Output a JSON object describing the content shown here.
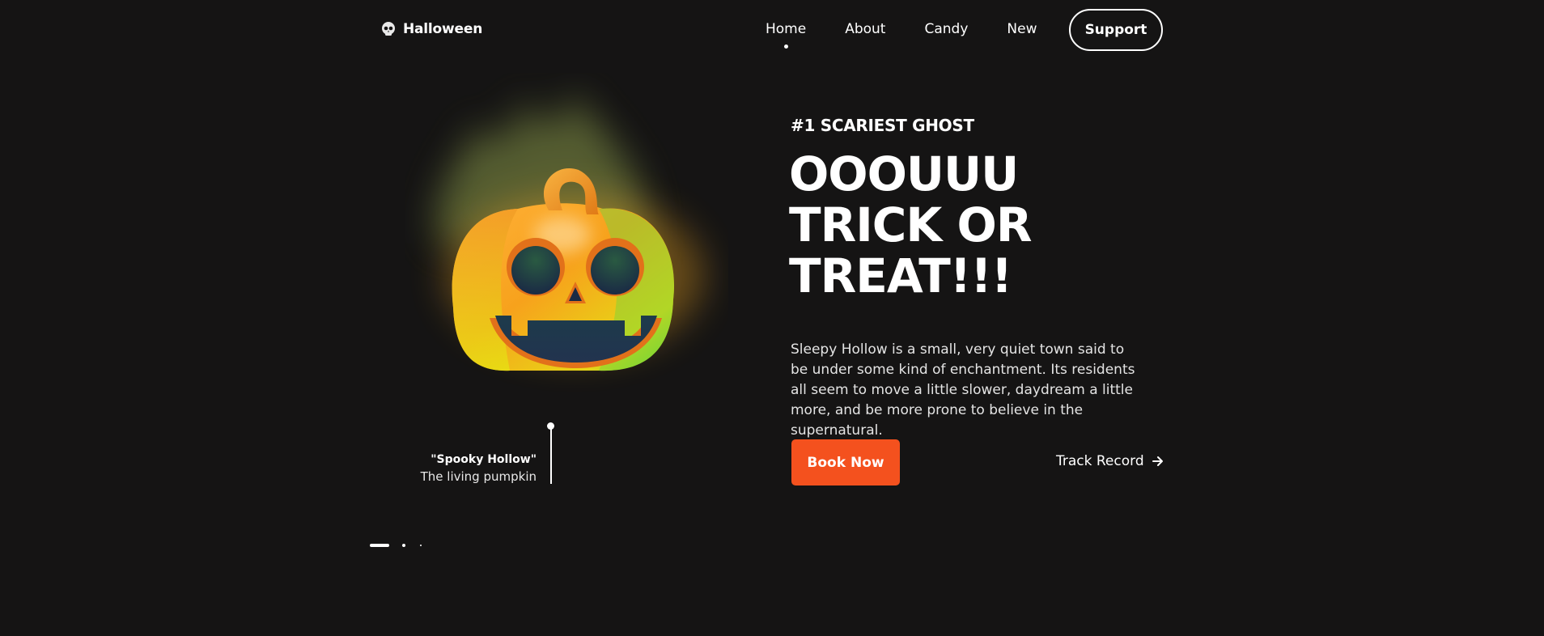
{
  "brand": {
    "name": "Halloween",
    "icon": "skull-icon"
  },
  "nav": {
    "items": [
      "Home",
      "About",
      "Candy",
      "New"
    ],
    "active_index": 0,
    "support_label": "Support"
  },
  "hero": {
    "eyebrow": "#1 SCARIEST GHOST",
    "headline_lines": [
      "OOOUUU",
      "TRICK OR",
      "TREAT!!!"
    ],
    "description": "Sleepy Hollow is a small, very quiet town said to be under some kind of enchantment. Its residents all seem to move a little slower, daydream a little more, and be more prone to believe in the supernatural.",
    "book_label": "Book Now",
    "track_label": "Track Record",
    "track_icon": "arrow-right-icon",
    "accent_color": "#f4511e"
  },
  "figure": {
    "icon": "pumpkin-illustration",
    "caption_title": "\"Spooky Hollow\"",
    "caption_sub": "The living pumpkin"
  },
  "slider": {
    "count": 3,
    "active_index": 0
  }
}
